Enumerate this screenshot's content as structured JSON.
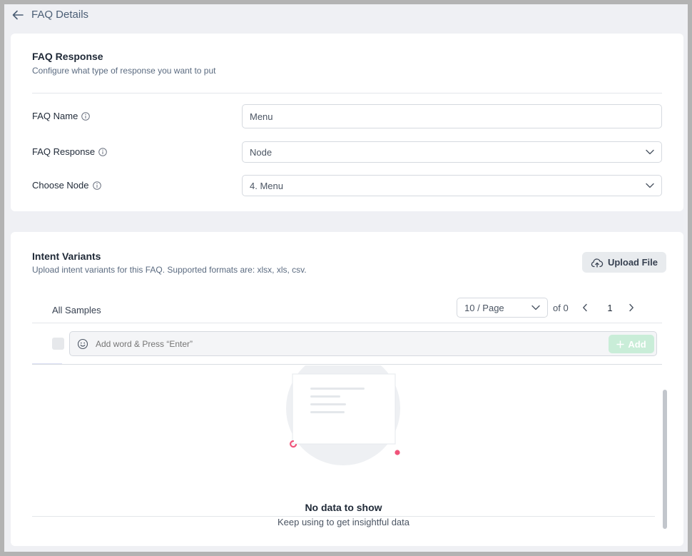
{
  "header": {
    "title": "FAQ Details",
    "back_icon": "arrow-left-icon"
  },
  "faq_response_section": {
    "title": "FAQ Response",
    "subtitle": "Configure what type of response you want to put",
    "fields": {
      "name": {
        "label": "FAQ Name",
        "value": "Menu"
      },
      "response": {
        "label": "FAQ Response",
        "value": "Node"
      },
      "node": {
        "label": "Choose Node",
        "value": "4. Menu"
      }
    }
  },
  "intent_section": {
    "title": "Intent Variants",
    "subtitle": "Upload intent variants for this FAQ. Supported formats are: xlsx, xls, csv.",
    "upload_label": "Upload File",
    "samples_label": "All Samples",
    "per_page": "10 / Page",
    "of_total": "of 0",
    "current_page": "1",
    "add_placeholder": "Add word & Press “Enter”",
    "add_label": "Add",
    "empty_title": "No data to show",
    "empty_subtitle": "Keep using to get insightful data"
  },
  "colors": {
    "accent_green": "#c9edd8",
    "page_bg": "#eff0f4",
    "empty_dot_pink": "#f0547a"
  }
}
